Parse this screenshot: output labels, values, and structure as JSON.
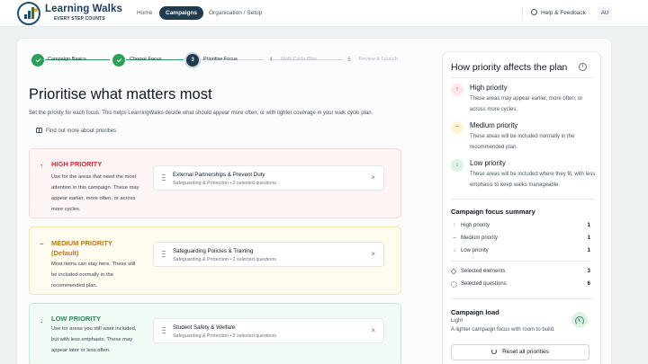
{
  "brand": {
    "title": "Learning Walks",
    "subtitle": "EVERY STEP COUNTS"
  },
  "nav": {
    "home": "Home",
    "campaigns": "Campaigns",
    "organisation": "Organisation / Setup"
  },
  "header": {
    "help": "Help & Feedback",
    "avatar": "AU"
  },
  "stepper": {
    "steps": [
      {
        "num": "1",
        "label": "Campaign Basics",
        "state": "done"
      },
      {
        "num": "2",
        "label": "Choose Focus",
        "state": "done"
      },
      {
        "num": "3",
        "label": "Prioritise Focus",
        "state": "current"
      },
      {
        "num": "4",
        "label": "Walk Cycle Plan",
        "state": "future"
      },
      {
        "num": "5",
        "label": "Review & Launch",
        "state": "future"
      }
    ]
  },
  "page": {
    "title": "Prioritise what matters most",
    "description": "Set the priority for each focus. This helps LearningWalks decide what should appear more often, or with lighter coverage in your walk cycle plan.",
    "find_out": "Find out more about priorities"
  },
  "priorities": {
    "high": {
      "title": "HIGH PRIORITY",
      "desc": "Use for the areas that need the most attention in this campaign. These may appear earlier, more often, or across more cycles.",
      "item": {
        "title": "External Partnerships & Prevent Duty",
        "sub": "Safeguarding & Protection • 2 selected questions"
      }
    },
    "medium": {
      "title": "MEDIUM PRIORITY (Default)",
      "desc": "Most items can stay here. These will be included normally in the recommended plan.",
      "item": {
        "title": "Safeguarding Policies & Training",
        "sub": "Safeguarding & Protection • 2 selected questions"
      }
    },
    "low": {
      "title": "LOW PRIORITY",
      "desc": "Use for areas you still want included, but with less emphasis. These may appear later or less often.",
      "item": {
        "title": "Student Safety & Welfare",
        "sub": "Safeguarding & Protection • 2 selected questions"
      }
    }
  },
  "panel": {
    "title": "How priority affects the plan",
    "high": {
      "title": "High priority",
      "desc": "These areas may appear earlier, more often, or across more cycles."
    },
    "medium": {
      "title": "Medium priority",
      "desc": "These areas will be included normally in the recommended plan."
    },
    "low": {
      "title": "Low priority",
      "desc": "These areas will be included where they fit, with less emphasis to keep walks manageable."
    },
    "summary": {
      "title": "Campaign focus summary",
      "high_label": "High priority",
      "high_value": "1",
      "medium_label": "Medium priority",
      "medium_value": "1",
      "low_label": "Low priority",
      "low_value": "1",
      "elements_label": "Selected elements",
      "elements_value": "3",
      "questions_label": "Selected questions",
      "questions_value": "6"
    },
    "load": {
      "title": "Campaign load",
      "level": "Light",
      "desc": "A lighter campaign focus with room to build."
    },
    "reset": "Reset all priorities"
  }
}
